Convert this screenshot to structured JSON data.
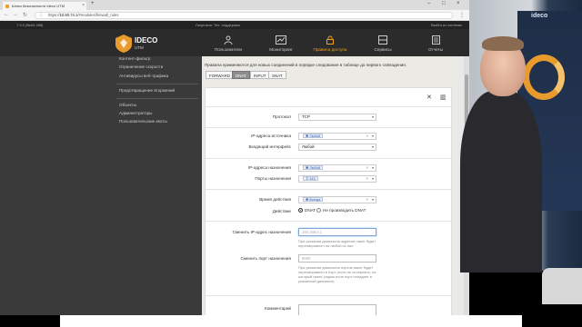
{
  "browser": {
    "tab_title": "Шлюз безопасности Ideco UTM",
    "url_host": "10.80.74.1",
    "url_path": "/#modules/firewall_rules",
    "url_prefix": "https://"
  },
  "app": {
    "version": "7.9.0 (Build 288)",
    "license": "Лицензия: Тех. поддержка",
    "logout": "Выйти из системы",
    "logo_text": "IDECO",
    "logo_sub": "UTM",
    "nav": [
      {
        "label": "Пользователи",
        "icon": "users-icon"
      },
      {
        "label": "Мониторинг",
        "icon": "monitoring-icon"
      },
      {
        "label": "Правила доступа",
        "icon": "lock-icon",
        "active": true
      },
      {
        "label": "Сервисы",
        "icon": "services-icon"
      },
      {
        "label": "Отчеты",
        "icon": "reports-icon"
      }
    ]
  },
  "sidebar": {
    "items": [
      "Контент-фильтр",
      "Ограничение скорости",
      "Антивирусы веб-трафика",
      "Предотвращение вторжений",
      "Объекты",
      "Администраторы",
      "Пользовательские квоты"
    ]
  },
  "main": {
    "hint": "Правила применяются для новых соединений в порядке следования в таблице до первого совпадения.",
    "chips": [
      "FORWARD",
      "DNAT",
      "INPUT",
      "SNAT"
    ],
    "active_chip": "DNAT",
    "form": {
      "protocol_label": "Протокол",
      "protocol_value": "TCP",
      "src_ip_label": "IP-адреса источника",
      "src_ip_value": "Любой",
      "iface_label": "Входящий интерфейс",
      "iface_value": "Любой",
      "dst_ip_label": "IP-адреса назначения",
      "dst_ip_value": "Любой",
      "dst_port_label": "Порты назначения",
      "dst_port_value": "443",
      "time_label": "Время действия",
      "time_value": "Всегда",
      "action_label": "Действие",
      "action_dnat": "DNAT",
      "action_nodnat": "Не производить DNAT",
      "change_ip_label": "Сменить IP-адрес назначения",
      "change_ip_placeholder": "192.168.0.1",
      "change_ip_help": "При указании диапазона адресов пакет будет перенаправлен на любой из них.",
      "change_port_label": "Сменить порт назначения",
      "change_port_placeholder": "8080",
      "change_port_help": "При указании диапазона портов пакет будет перенаправлен в порт (если не исчерпано, на который пакет, рядом если порт попадает в указанный диапазон).",
      "comment_label": "Комментарий"
    }
  },
  "webcam": {
    "brand": "ideco"
  }
}
